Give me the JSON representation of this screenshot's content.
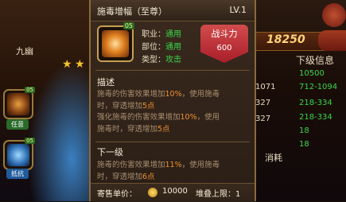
{
  "background": {
    "hero_name": "九幽",
    "stars": 2,
    "skill_slots": [
      {
        "badge": "05",
        "label": "任意",
        "style": "orange"
      },
      {
        "badge": "05",
        "label": "抵抗",
        "style": "blue"
      }
    ],
    "power_score": "18250",
    "lower_level_title": "下级信息",
    "left_values": [
      "1071",
      "327",
      "327"
    ],
    "right_values": [
      "10500",
      "712-1094",
      "218-334",
      "218-334",
      "18",
      "18"
    ],
    "consume_label": "消耗"
  },
  "tooltip": {
    "title": "施毒增幅（至尊）",
    "level": "LV.1",
    "icon_badge": "05",
    "attributes": [
      {
        "label": "职业：",
        "value": "通用"
      },
      {
        "label": "部位：",
        "value": "通用"
      },
      {
        "label": "类型：",
        "value": "攻击"
      }
    ],
    "combat_power_label": "战斗力",
    "combat_power_value": "600",
    "description_title": "描述",
    "description_line1_a": "施毒的伤害效果增加",
    "description_line1_b": "10%",
    "description_line1_c": "，使用施毒",
    "description_line2_a": "时，穿透增加",
    "description_line2_b": "5点",
    "description_line3_a": "强化施毒的伤害效果增加",
    "description_line3_b": "10%",
    "description_line3_c": "，使用",
    "description_line4_a": "施毒时，穿透增加",
    "description_line4_b": "5点",
    "next_level_title": "下一级",
    "next_line1_a": "施毒的伤害效果增加",
    "next_line1_b": "11%",
    "next_line1_c": "，使用施毒",
    "next_line2_a": "时，穿透增加",
    "next_line2_b": "6点",
    "price_label": "寄售单价：",
    "price_value": "10000",
    "stack_limit": "堆叠上限：1"
  },
  "colors": {
    "highlight": "#f09030",
    "green_value": "#3ad64a",
    "power_red": "#c83a3a"
  }
}
